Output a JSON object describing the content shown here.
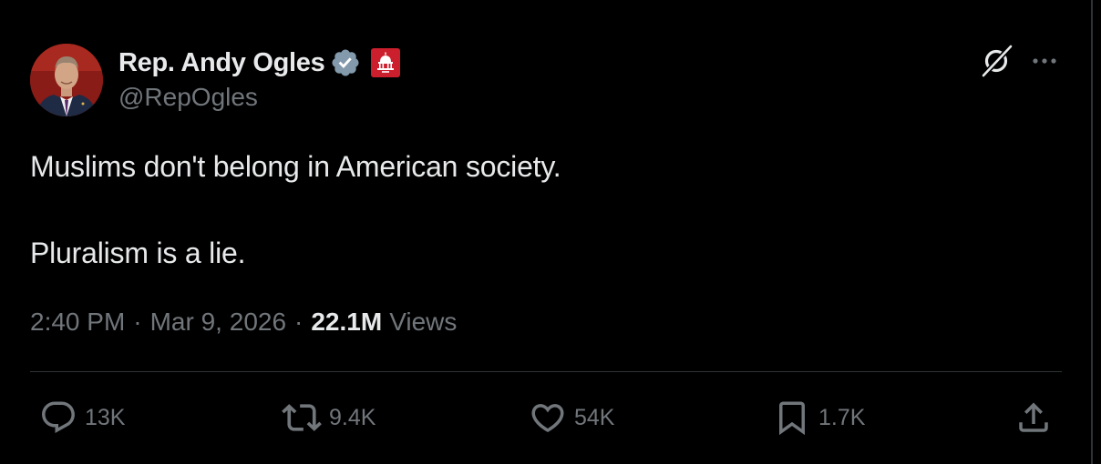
{
  "author": {
    "display_name": "Rep. Andy Ogles",
    "handle": "@RepOgles",
    "verified_color": "#829aab",
    "affiliation_badge_color": "#cc1f2d"
  },
  "tweet": {
    "lines": [
      "Muslims don't belong in American society.",
      "Pluralism is a lie."
    ],
    "time": "2:40 PM",
    "separator": "·",
    "date": "Mar 9, 2026",
    "views_count": "22.1M",
    "views_label": "Views"
  },
  "actions": {
    "reply": "13K",
    "retweet": "9.4K",
    "like": "54K",
    "bookmark": "1.7K"
  },
  "icons": {
    "grok": "grok-icon",
    "more": "more-icon",
    "reply": "reply-icon",
    "retweet": "retweet-icon",
    "like": "heart-icon",
    "bookmark": "bookmark-icon",
    "share": "share-icon"
  },
  "colors": {
    "background": "#000000",
    "text": "#e7e9ea",
    "secondary": "#71767b",
    "divider": "#2f3336"
  }
}
